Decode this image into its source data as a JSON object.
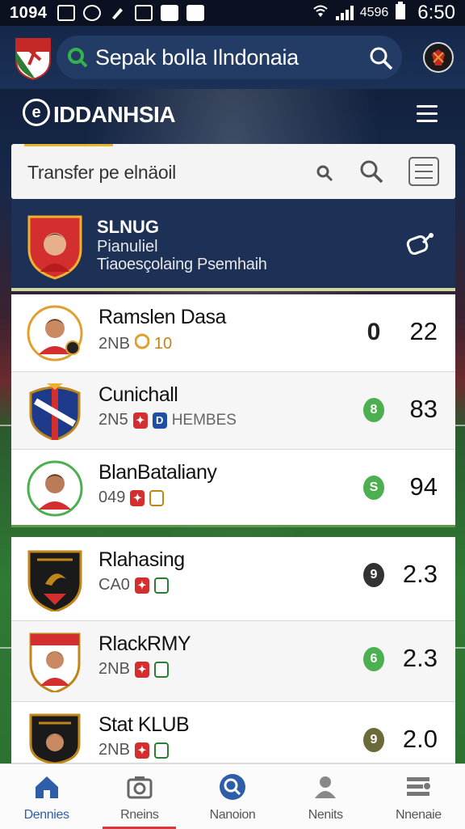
{
  "status_bar": {
    "time": "1094",
    "battery_text": "4596",
    "clock": "6:50"
  },
  "app_bar": {
    "title": "Sepak bolla Ilndonaia"
  },
  "brand": {
    "logo_letter": "e",
    "name": "IDDANHSIA"
  },
  "transfer_search": {
    "label": "Transfer pe elnäoil"
  },
  "featured_club": {
    "title": "SLNUG",
    "subtitle": "Pianuliel",
    "description": "Tiaoesçolaing Psemhaih"
  },
  "clubs": [
    {
      "name": "Ramslen Dasa",
      "code": "2NB",
      "extra": "10",
      "extra_color": "#c0861a",
      "badges": [],
      "status_glyph": "0",
      "status_color": "plain",
      "score": "22"
    },
    {
      "name": "Cunichall",
      "code": "2N5",
      "extra": "HEMBES",
      "badges": [
        "red",
        "blue"
      ],
      "status_glyph": "8",
      "status_color": "#4caf50",
      "score": "83"
    },
    {
      "name": "BlanBataliany",
      "code": "049",
      "extra": "",
      "badges": [
        "red",
        "yellow"
      ],
      "status_glyph": "S",
      "status_color": "#4caf50",
      "score": "94"
    },
    {
      "name": "Rlahasing",
      "code": "CA0",
      "extra": "",
      "badges": [
        "red",
        "green"
      ],
      "status_glyph": "9",
      "status_color": "#333333",
      "score": "2.3"
    },
    {
      "name": "RlackRMY",
      "code": "2NB",
      "extra": "",
      "badges": [
        "red",
        "green"
      ],
      "status_glyph": "6",
      "status_color": "#4caf50",
      "score": "2.3"
    },
    {
      "name": "Stat KLUB",
      "code": "2NB",
      "extra": "",
      "badges": [
        "red",
        "green"
      ],
      "status_glyph": "9",
      "status_color": "#6b6b3a",
      "score": "2.0"
    }
  ],
  "bottom_nav": [
    {
      "label": "Dennies",
      "icon": "home-icon",
      "active": true
    },
    {
      "label": "Rneins",
      "icon": "camera-icon",
      "active": false
    },
    {
      "label": "Nanoion",
      "icon": "search-icon",
      "active": false
    },
    {
      "label": "Nenits",
      "icon": "players-icon",
      "active": false
    },
    {
      "label": "Nnenaie",
      "icon": "list-icon",
      "active": false
    }
  ],
  "colors": {
    "app_bar": "#1b3157",
    "accent_blue": "#2e5ea8",
    "accent_red": "#d23a3a",
    "tab_accent": "#e6b52c",
    "status_green": "#4caf50"
  }
}
